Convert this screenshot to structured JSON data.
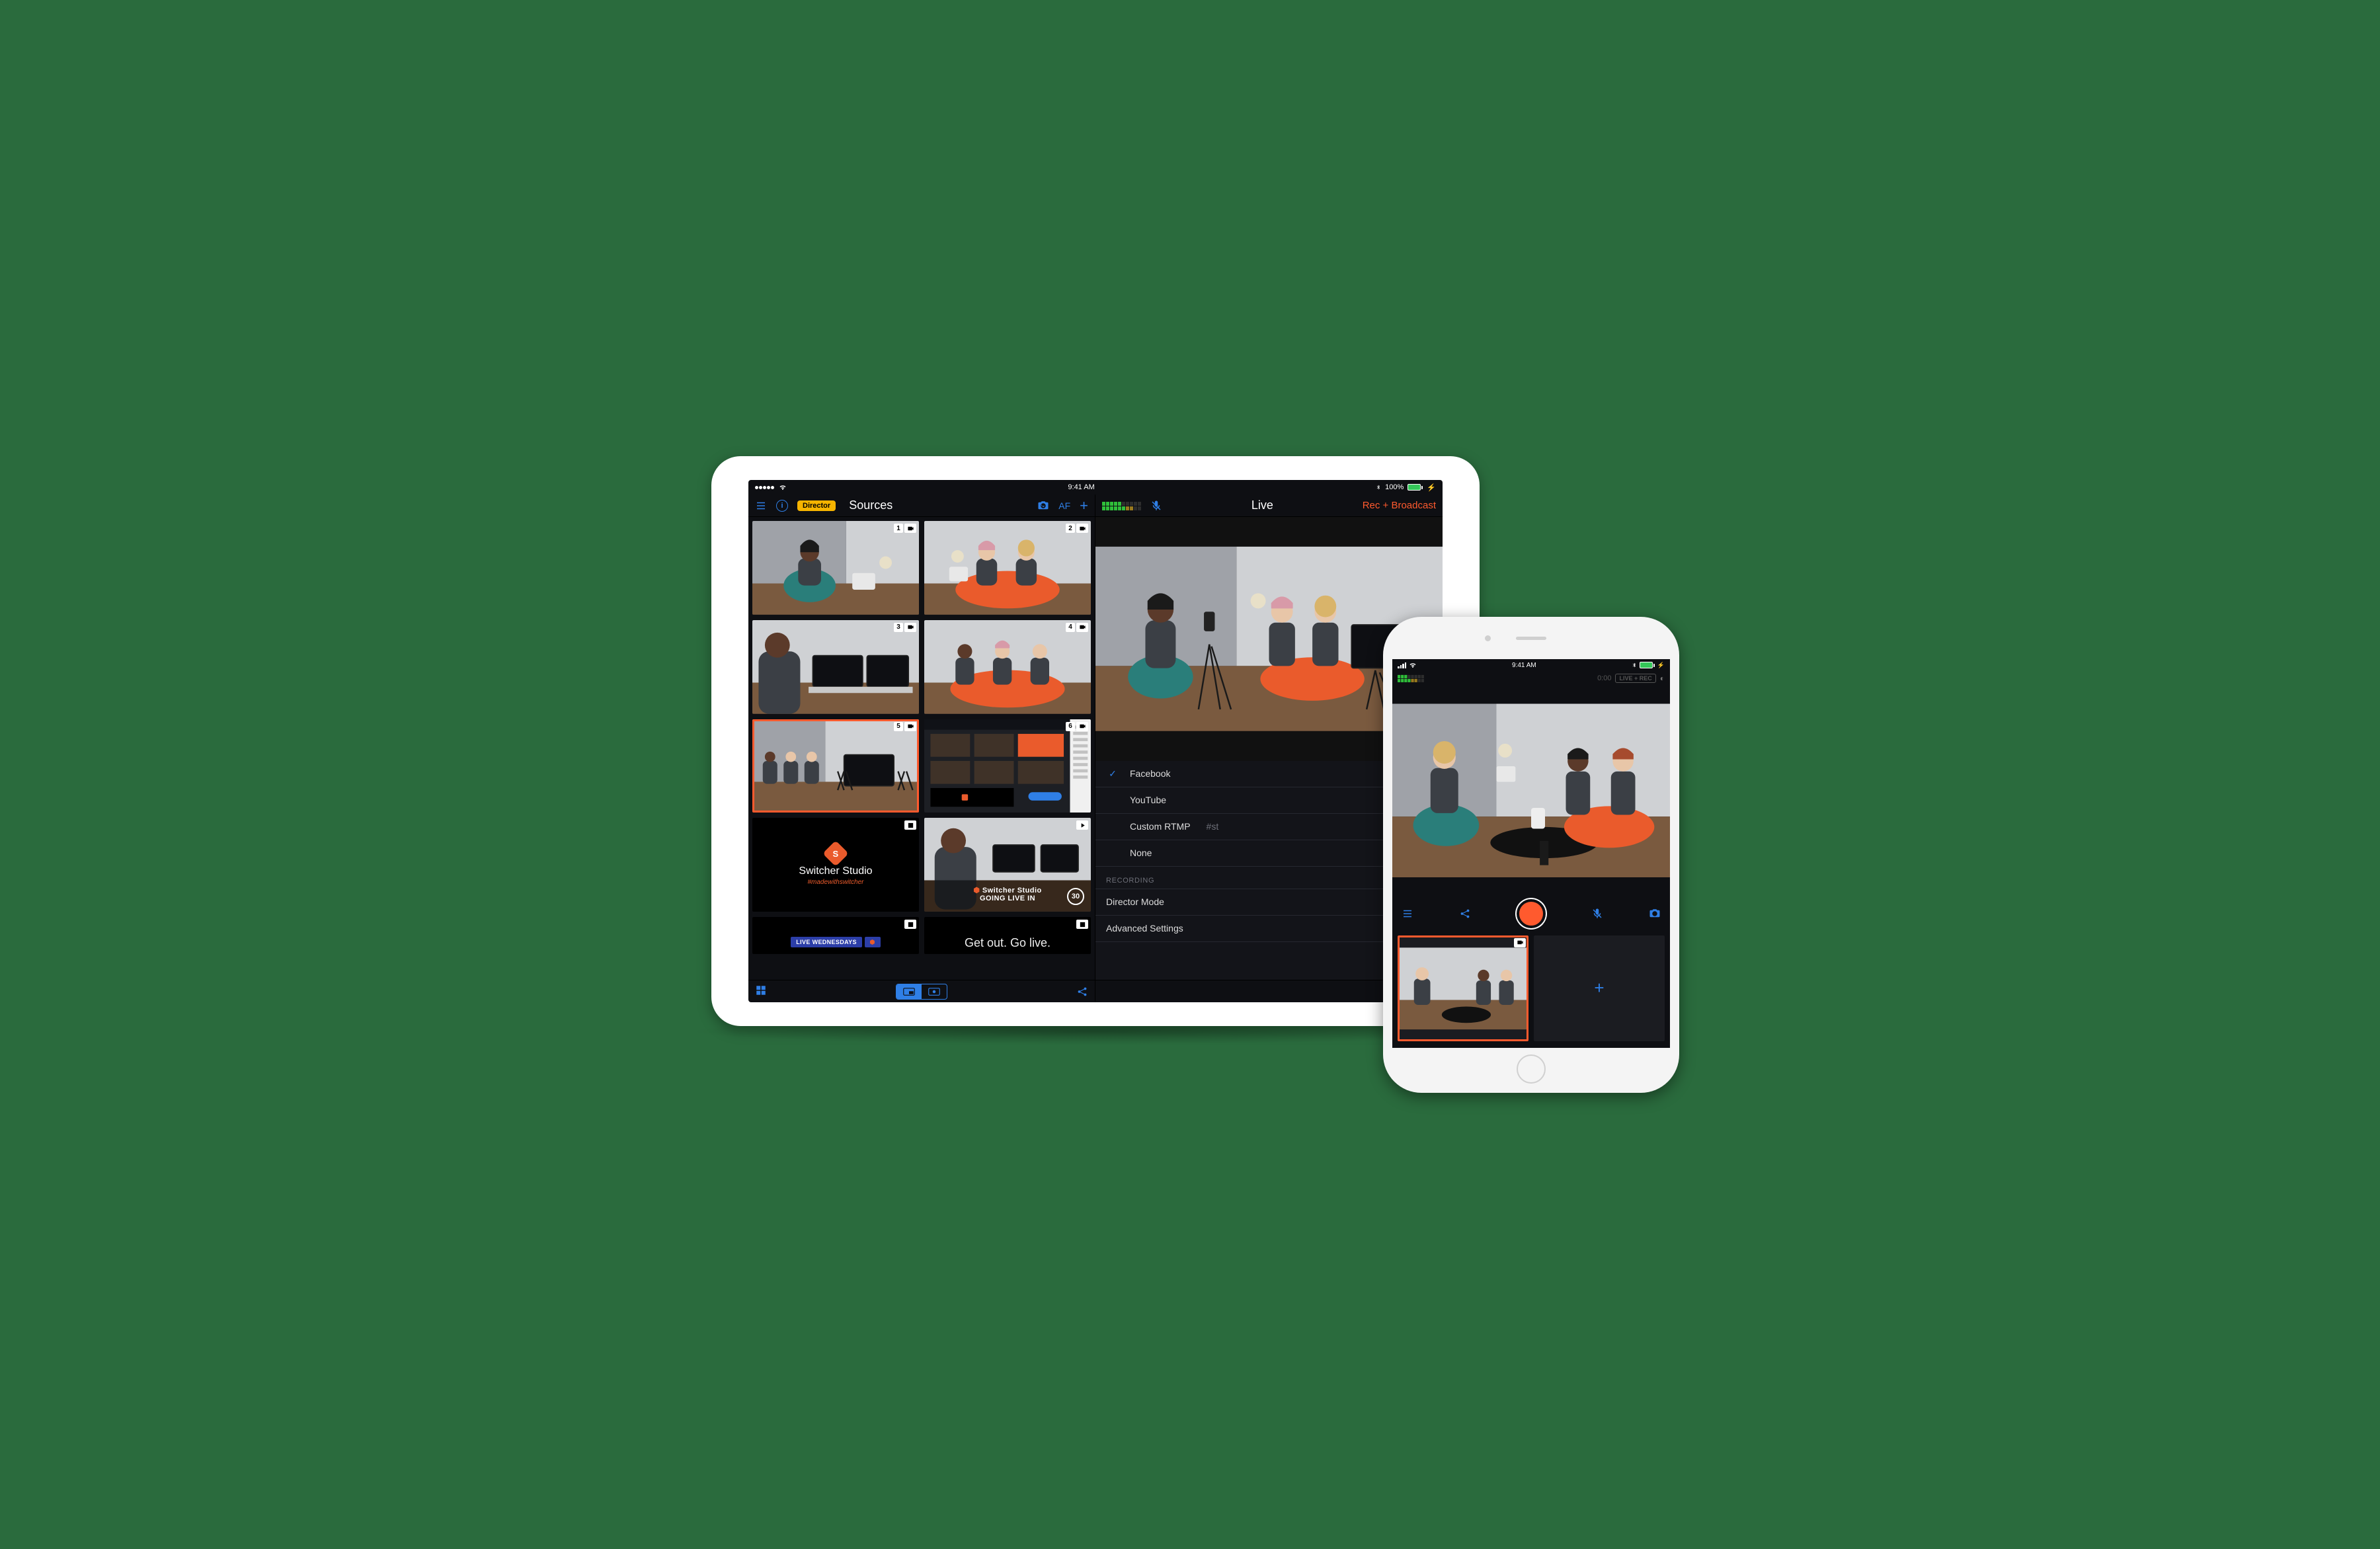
{
  "statusbar": {
    "time": "9:41 AM",
    "battery": "100%"
  },
  "ipad": {
    "left_toolbar": {
      "director_pill": "Director",
      "title": "Sources",
      "af_label": "AF"
    },
    "right_toolbar": {
      "title": "Live",
      "action": "Rec + Broadcast"
    },
    "sources": [
      {
        "num": "1",
        "type": "camera"
      },
      {
        "num": "2",
        "type": "camera"
      },
      {
        "num": "3",
        "type": "camera"
      },
      {
        "num": "4",
        "type": "camera"
      },
      {
        "num": "5",
        "type": "camera",
        "selected": true
      },
      {
        "num": "6",
        "type": "camera"
      },
      {
        "type": "image",
        "logo": {
          "name": "Switcher Studio",
          "tag": "#madewithswitcher"
        }
      },
      {
        "type": "video",
        "countdown": {
          "brand": "Switcher Studio",
          "line": "GOING LIVE IN",
          "num": "30"
        }
      },
      {
        "type": "image",
        "banner": "LIVE WEDNESDAYS"
      },
      {
        "type": "image",
        "golive": "Get out. Go live."
      }
    ],
    "streaming": {
      "options": [
        {
          "label": "Facebook",
          "checked": true
        },
        {
          "label": "YouTube",
          "checked": false
        },
        {
          "label": "Custom RTMP",
          "sub": "#st",
          "checked": false
        },
        {
          "label": "None",
          "checked": false
        }
      ],
      "recording_header": "RECORDING",
      "recording_rows": [
        "Director Mode",
        "Advanced Settings"
      ]
    }
  },
  "iphone": {
    "timer": "0:00",
    "pill": "LIVE + REC"
  }
}
